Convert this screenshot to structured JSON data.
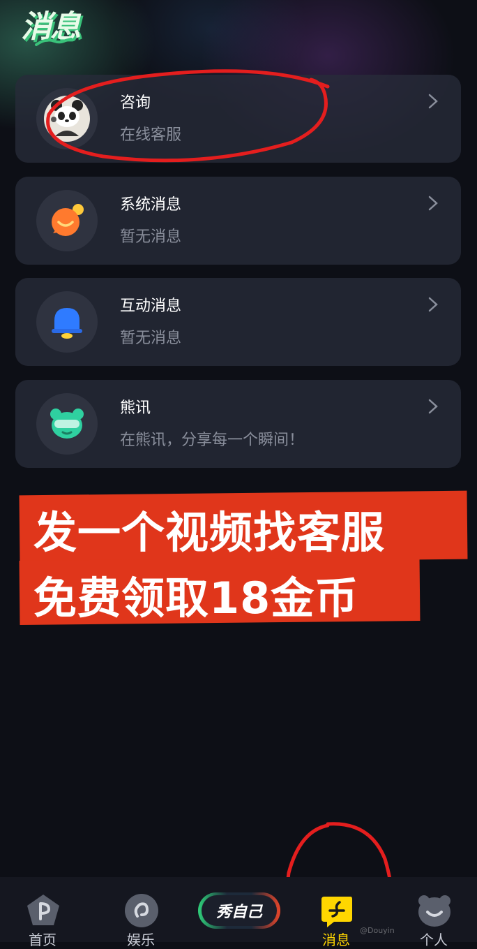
{
  "page": {
    "title": "消息"
  },
  "cards": [
    {
      "title": "咨询",
      "subtitle": "在线客服",
      "icon": "panda-avatar-icon"
    },
    {
      "title": "系统消息",
      "subtitle": "暂无消息",
      "icon": "chat-bubble-icon"
    },
    {
      "title": "互动消息",
      "subtitle": "暂无消息",
      "icon": "bell-icon"
    },
    {
      "title": "熊讯",
      "subtitle": "在熊讯，分享每一个瞬间！",
      "icon": "bear-face-icon"
    }
  ],
  "promo": {
    "line1": "发一个视频找客服",
    "line2": "免费领取18金币"
  },
  "tabbar": {
    "home": "首页",
    "entertainment": "娱乐",
    "show_self": "秀自己",
    "messages": "消息",
    "profile": "个人",
    "active": "消息"
  },
  "watermark": "@Douyin",
  "colors": {
    "accent": "#ffd600",
    "promo": "#e0361b",
    "annotation": "#e41e1e"
  }
}
